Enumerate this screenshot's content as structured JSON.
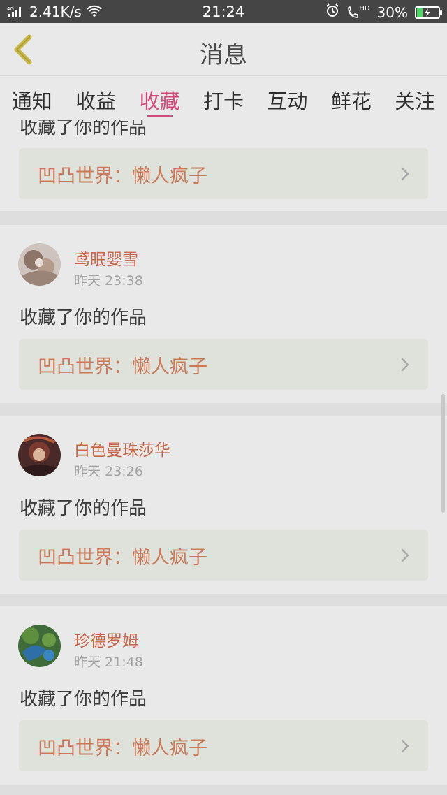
{
  "status": {
    "network": "4G",
    "speed": "2.41K/s",
    "time": "21:24",
    "hd": "HD",
    "battery": "30%",
    "battery_level": 0.3,
    "accent": "#4cd964"
  },
  "header": {
    "title": "消息"
  },
  "tabs": [
    {
      "label": "通知"
    },
    {
      "label": "收益"
    },
    {
      "label": "收藏"
    },
    {
      "label": "打卡"
    },
    {
      "label": "互动"
    },
    {
      "label": "鲜花"
    },
    {
      "label": "关注"
    }
  ],
  "active_tab": "收藏",
  "top_partial": {
    "action": "收藏了你的作品",
    "work": "凹凸世界：懒人疯子"
  },
  "items": [
    {
      "user": "鸢眠婴雪",
      "time": "昨天 23:38",
      "action": "收藏了你的作品",
      "work": "凹凸世界：懒人疯子"
    },
    {
      "user": "白色曼珠莎华",
      "time": "昨天 23:26",
      "action": "收藏了你的作品",
      "work": "凹凸世界：懒人疯子"
    },
    {
      "user": "珍德罗姆",
      "time": "昨天 21:48",
      "action": "收藏了你的作品",
      "work": "凹凸世界：懒人疯子"
    }
  ]
}
